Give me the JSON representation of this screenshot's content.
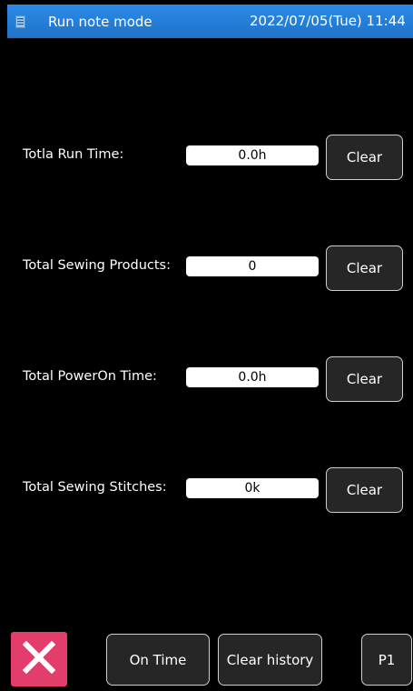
{
  "header": {
    "title": "Run note mode",
    "datetime": "2022/07/05(Tue) 11:44"
  },
  "rows": [
    {
      "label": "Totla Run Time:",
      "value": "0.0h",
      "button": "Clear"
    },
    {
      "label": "Total Sewing Products:",
      "value": "0",
      "button": "Clear"
    },
    {
      "label": "Total PowerOn Time:",
      "value": "0.0h",
      "button": "Clear"
    },
    {
      "label": "Total Sewing Stitches:",
      "value": "0k",
      "button": "Clear"
    }
  ],
  "footer": {
    "close_icon": "close-icon",
    "on_time_label": "On Time",
    "clear_history_label": "Clear history",
    "page_label": "P1"
  },
  "colors": {
    "titlebar": "#2379d6",
    "close_button": "#e23d6b",
    "background": "#000000",
    "button_fill": "#262626"
  }
}
